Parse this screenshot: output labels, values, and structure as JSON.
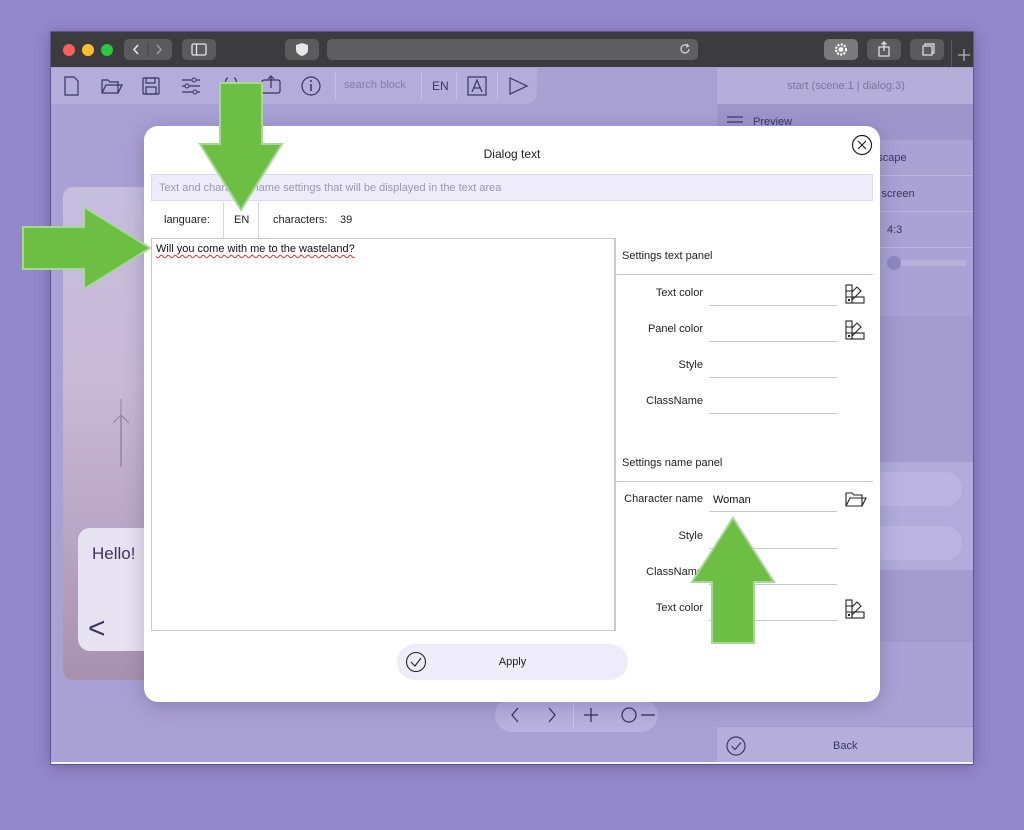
{
  "toolbar": {
    "search_placeholder": "search block",
    "language": "EN"
  },
  "right_panel": {
    "title": "start (scene:1 | dialog:3)",
    "preview_label": "Preview",
    "rows": [
      "ndscape",
      "v screen",
      "4:3"
    ],
    "back_label": "Back"
  },
  "scene": {
    "bubble_text": "Hello!",
    "bubble_nav": "<"
  },
  "modal": {
    "title": "Dialog text",
    "hint": "Text and character name settings that will be displayed in the text area",
    "language_label": "languare:",
    "language_value": "EN",
    "characters_label": "characters:",
    "characters_value": "39",
    "text_value": "Will you come with me to the wasteland?",
    "text_panel": {
      "title": "Settings text panel",
      "fields": [
        {
          "label": "Text color",
          "value": ""
        },
        {
          "label": "Panel color",
          "value": ""
        },
        {
          "label": "Style",
          "value": ""
        },
        {
          "label": "ClassName",
          "value": ""
        }
      ]
    },
    "name_panel": {
      "title": "Settings name panel",
      "fields": [
        {
          "label": "Character name",
          "value": "Woman"
        },
        {
          "label": "Style",
          "value": ""
        },
        {
          "label": "ClassName",
          "value": ""
        },
        {
          "label": "Text color",
          "value": ""
        }
      ]
    },
    "apply_label": "Apply"
  },
  "colors": {
    "background": "#9488cc",
    "accent_light": "#eeecfb",
    "arrow_green": "#6cbf43"
  }
}
